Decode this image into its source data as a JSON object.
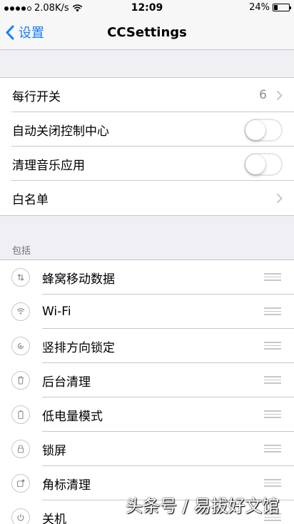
{
  "status_bar": {
    "speed": "2.08K/s",
    "time": "12:09",
    "battery_percent": "24%",
    "battery_level": 0.24,
    "icons": [
      "signal-dots-icon",
      "wifi-icon",
      "battery-icon"
    ]
  },
  "nav": {
    "back_label": "设置",
    "title": "CCSettings",
    "accent_color": "#157efb"
  },
  "general": [
    {
      "label": "每行开关",
      "value": "6",
      "control": "chevron"
    },
    {
      "label": "自动关闭控制中心",
      "control": "toggle",
      "on": false
    },
    {
      "label": "清理音乐应用",
      "control": "toggle",
      "on": false
    },
    {
      "label": "白名单",
      "control": "chevron"
    }
  ],
  "include": {
    "header": "包括",
    "items": [
      {
        "label": "蜂窝移动数据",
        "icon": "cellular-data-icon"
      },
      {
        "label": "Wi-Fi",
        "icon": "wifi-icon"
      },
      {
        "label": "竖排方向锁定",
        "icon": "rotation-lock-icon"
      },
      {
        "label": "后台清理",
        "icon": "trash-icon"
      },
      {
        "label": "低电量模式",
        "icon": "low-power-icon"
      },
      {
        "label": "锁屏",
        "icon": "lock-icon"
      },
      {
        "label": "角标清理",
        "icon": "badge-clear-icon"
      },
      {
        "label": "关机",
        "icon": "power-icon"
      }
    ]
  },
  "watermark": "头条号 / 易拔好文馆"
}
